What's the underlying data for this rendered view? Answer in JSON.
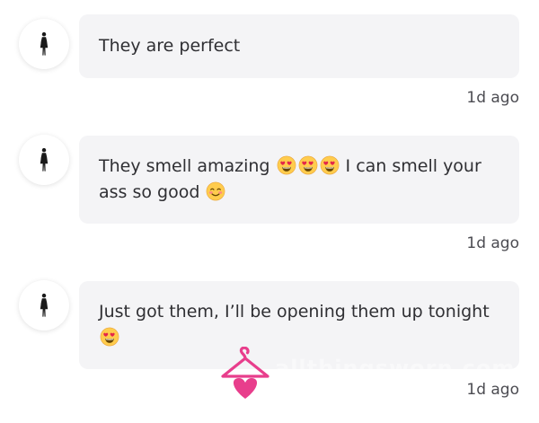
{
  "comments": [
    {
      "avatar_icon": "woman-silhouette-icon",
      "text_parts": [
        "They are perfect"
      ],
      "time": "1d ago"
    },
    {
      "avatar_icon": "woman-silhouette-icon",
      "text_parts": [
        "They smell amazing ",
        " I can smell your ass so good "
      ],
      "emojis": [
        "heart-eyes-emoji",
        "heart-eyes-emoji",
        "heart-eyes-emoji",
        "smiling-blush-emoji"
      ],
      "time": "1d ago"
    },
    {
      "avatar_icon": "woman-silhouette-icon",
      "text_parts": [
        "Just got them, I’ll be opening them up tonight "
      ],
      "emojis": [
        "heart-eyes-emoji"
      ],
      "time": "1d ago"
    }
  ],
  "watermark": {
    "logo_icon": "hanger-heart-logo",
    "text": "allthingsworn.com",
    "color": "#e83e8c"
  },
  "colors": {
    "bubble_bg": "#f4f4f6",
    "text": "#2f2f33",
    "timestamp": "#4c4c52"
  }
}
